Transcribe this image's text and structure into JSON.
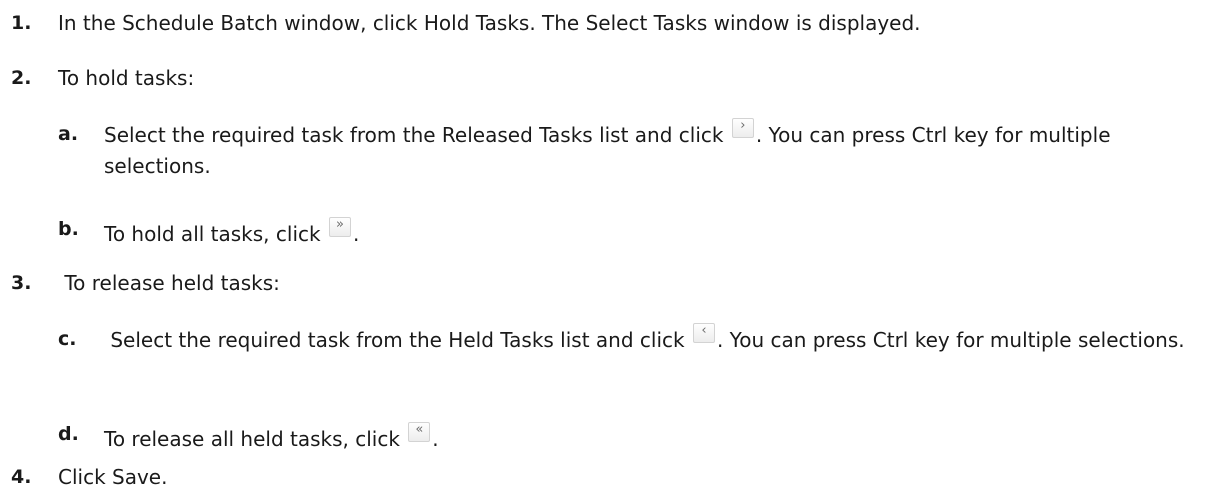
{
  "steps": [
    {
      "number": "1.",
      "text": "In the Schedule Batch window, click Hold Tasks. The Select Tasks window is displayed."
    },
    {
      "number": "2.",
      "text": "To hold tasks:",
      "substeps": [
        {
          "letter": "a.",
          "text_before": "Select the required task from the Released Tasks list and click",
          "icon": "chevron-right-icon",
          "icon_glyph": "›",
          "text_after": ". You can press Ctrl key for multiple selections."
        },
        {
          "letter": "b.",
          "text_before": "To hold all tasks, click",
          "icon": "double-chevron-right-icon",
          "icon_glyph": "»",
          "text_after": "."
        }
      ]
    },
    {
      "number": "3.",
      "text": " To release held tasks:",
      "substeps": [
        {
          "letter": "c.",
          "text_before": " Select the required task from the Held Tasks list and click",
          "icon": "chevron-left-icon",
          "icon_glyph": "‹",
          "text_after": ". You can press Ctrl key for multiple selections."
        },
        {
          "letter": "d.",
          "text_before": "To release all held tasks, click",
          "icon": "double-chevron-left-icon",
          "icon_glyph": "«",
          "text_after": "."
        }
      ]
    },
    {
      "number": "4.",
      "text": "Click Save."
    }
  ]
}
